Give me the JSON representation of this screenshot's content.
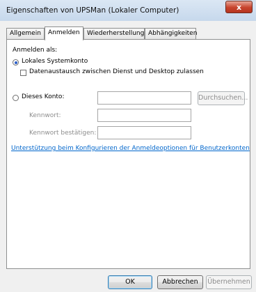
{
  "window": {
    "title": "Eigenschaften von UPSMan (Lokaler Computer)",
    "close_glyph": "x"
  },
  "tabs": [
    {
      "label": "Allgemein",
      "active": false
    },
    {
      "label": "Anmelden",
      "active": true
    },
    {
      "label": "Wiederherstellung",
      "active": false
    },
    {
      "label": "Abhängigkeiten",
      "active": false
    }
  ],
  "logon": {
    "section_label": "Anmelden als:",
    "local_system_label": "Lokales Systemkonto",
    "local_system_selected": true,
    "desktop_interact_label": "Datenaustausch zwischen Dienst und Desktop zulassen",
    "desktop_interact_checked": false,
    "this_account_label": "Dieses Konto:",
    "this_account_selected": false,
    "account_value": "",
    "browse_label": "Durchsuchen...",
    "password_label": "Kennwort:",
    "password_value": "",
    "confirm_password_label": "Kennwort bestätigen:",
    "confirm_password_value": "",
    "help_link": "Unterstützung beim Konfigurieren der Anmeldeoptionen für Benutzerkonten"
  },
  "buttons": {
    "ok": "OK",
    "cancel": "Abbrechen",
    "apply": "Übernehmen"
  }
}
